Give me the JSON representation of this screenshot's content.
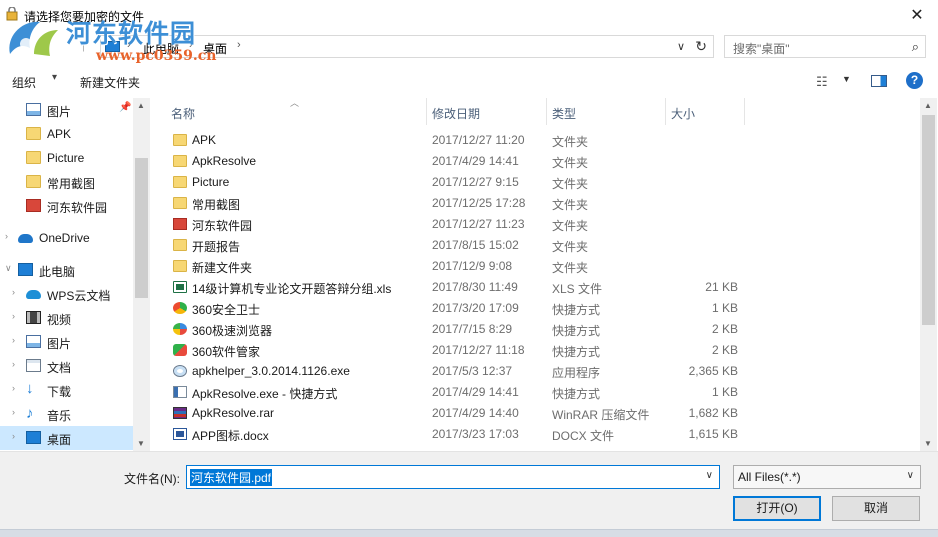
{
  "window": {
    "title": "请选择您要加密的文件"
  },
  "watermark": {
    "name": "河东软件园",
    "url": "www.pc0359.cn"
  },
  "address": {
    "crumbs": [
      "此电脑",
      "桌面"
    ],
    "search_placeholder": "搜索\"桌面\""
  },
  "toolbar": {
    "organize_label": "组织",
    "new_folder_label": "新建文件夹"
  },
  "nav": {
    "quick_access": [
      {
        "label": "图片",
        "icon": "pictures-icon"
      },
      {
        "label": "APK",
        "icon": "folder-icon"
      },
      {
        "label": "Picture",
        "icon": "folder-icon"
      },
      {
        "label": "常用截图",
        "icon": "folder-icon"
      },
      {
        "label": "河东软件园",
        "icon": "red-folder-icon"
      }
    ],
    "onedrive_label": "OneDrive",
    "this_pc_label": "此电脑",
    "this_pc_children": [
      {
        "label": "WPS云文档",
        "icon": "wps-cloud-icon"
      },
      {
        "label": "视频",
        "icon": "video-icon"
      },
      {
        "label": "图片",
        "icon": "pictures-icon"
      },
      {
        "label": "文档",
        "icon": "documents-icon"
      },
      {
        "label": "下载",
        "icon": "download-icon"
      },
      {
        "label": "音乐",
        "icon": "music-icon"
      },
      {
        "label": "桌面",
        "icon": "desktop-icon"
      }
    ],
    "selected": "桌面"
  },
  "columns": {
    "name": "名称",
    "date": "修改日期",
    "type": "类型",
    "size": "大小"
  },
  "files": [
    {
      "name": "APK",
      "date": "2017/12/27 11:20",
      "type": "文件夹",
      "size": "",
      "icon": "folder-icon"
    },
    {
      "name": "ApkResolve",
      "date": "2017/4/29 14:41",
      "type": "文件夹",
      "size": "",
      "icon": "folder-icon"
    },
    {
      "name": "Picture",
      "date": "2017/12/27 9:15",
      "type": "文件夹",
      "size": "",
      "icon": "folder-icon"
    },
    {
      "name": "常用截图",
      "date": "2017/12/25 17:28",
      "type": "文件夹",
      "size": "",
      "icon": "folder-icon"
    },
    {
      "name": "河东软件园",
      "date": "2017/12/27 11:23",
      "type": "文件夹",
      "size": "",
      "icon": "red-folder-icon"
    },
    {
      "name": "开题报告",
      "date": "2017/8/15 15:02",
      "type": "文件夹",
      "size": "",
      "icon": "folder-icon"
    },
    {
      "name": "新建文件夹",
      "date": "2017/12/9 9:08",
      "type": "文件夹",
      "size": "",
      "icon": "folder-icon"
    },
    {
      "name": "14级计算机专业论文开题答辩分组.xls",
      "date": "2017/8/30 11:49",
      "type": "XLS 文件",
      "size": "21 KB",
      "icon": "xls-file-icon"
    },
    {
      "name": "360安全卫士",
      "date": "2017/3/20 17:09",
      "type": "快捷方式",
      "size": "1 KB",
      "icon": "360-safe-icon"
    },
    {
      "name": "360极速浏览器",
      "date": "2017/7/15 8:29",
      "type": "快捷方式",
      "size": "2 KB",
      "icon": "360-browser-icon"
    },
    {
      "name": "360软件管家",
      "date": "2017/12/27 11:18",
      "type": "快捷方式",
      "size": "2 KB",
      "icon": "360-manager-icon"
    },
    {
      "name": "apkhelper_3.0.2014.1126.exe",
      "date": "2017/5/3 12:37",
      "type": "应用程序",
      "size": "2,365 KB",
      "icon": "exe-file-icon"
    },
    {
      "name": "ApkResolve.exe - 快捷方式",
      "date": "2017/4/29 14:41",
      "type": "快捷方式",
      "size": "1 KB",
      "icon": "shortcut-icon"
    },
    {
      "name": "ApkResolve.rar",
      "date": "2017/4/29 14:40",
      "type": "WinRAR 压缩文件",
      "size": "1,682 KB",
      "icon": "rar-file-icon"
    },
    {
      "name": "APP图标.docx",
      "date": "2017/3/23 17:03",
      "type": "DOCX 文件",
      "size": "1,615 KB",
      "icon": "docx-file-icon"
    }
  ],
  "footer": {
    "filename_label": "文件名(N):",
    "filename_value": "河东软件园.pdf",
    "filetype_value": "All Files(*.*)",
    "open_label": "打开(O)",
    "cancel_label": "取消"
  },
  "colors": {
    "accent": "#0078d7",
    "selection": "#cce8ff",
    "folder": "#f7d774",
    "watermark_blue": "#3d8fd6",
    "watermark_orange": "#e8632b"
  }
}
